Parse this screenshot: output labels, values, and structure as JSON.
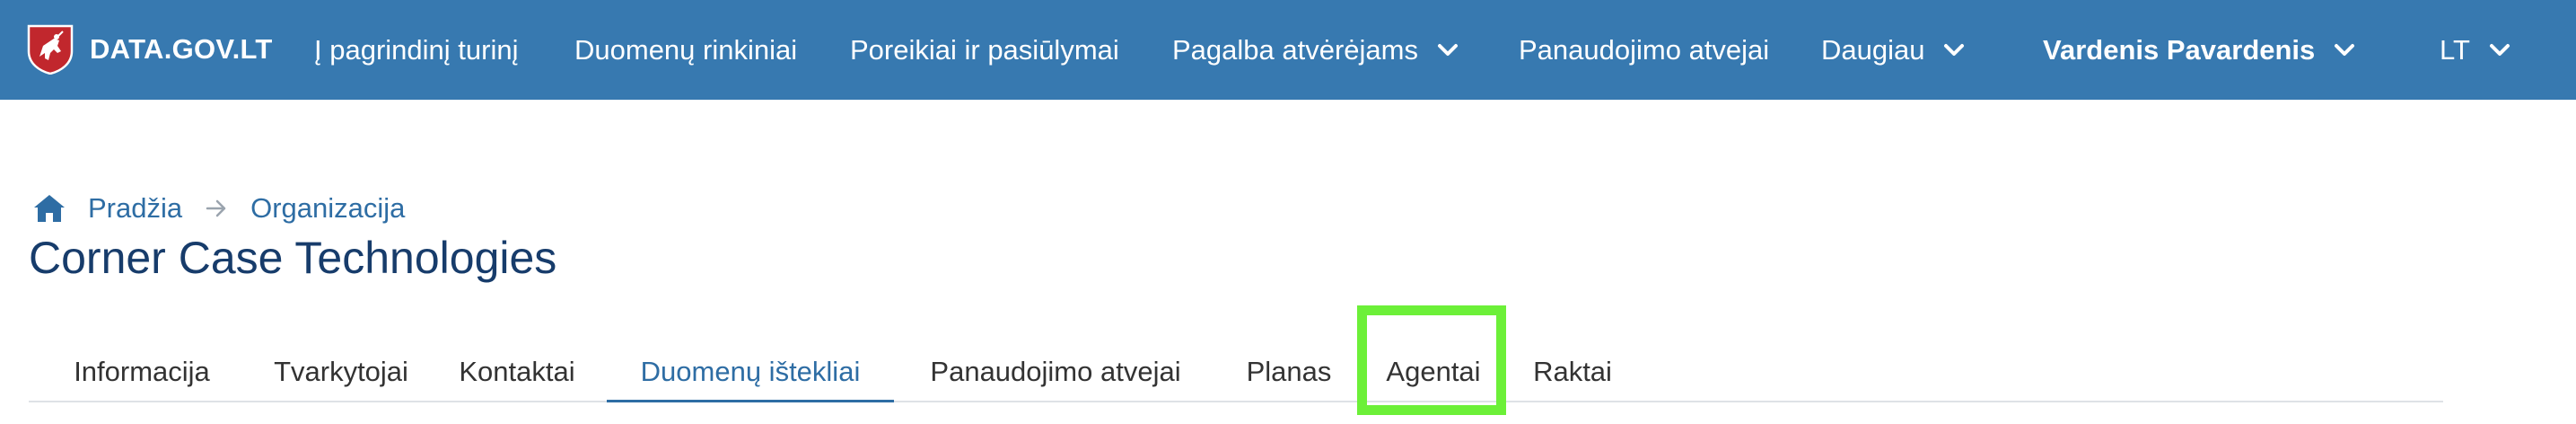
{
  "header": {
    "site_name": "DATA.GOV.LT",
    "nav": {
      "main_content": "Į pagrindinį turinį",
      "datasets": "Duomenų rinkiniai",
      "requests": "Poreikiai ir pasiūlymai",
      "help": "Pagalba atvėrėjams",
      "use_cases": "Panaudojimo atvejai",
      "more": "Daugiau",
      "user": "Vardenis Pavardenis",
      "language": "LT"
    }
  },
  "breadcrumb": {
    "home": "Pradžia",
    "organization": "Organizacija"
  },
  "page": {
    "title": "Corner Case Technologies"
  },
  "tabs": {
    "info": "Informacija",
    "managers": "Tvarkytojai",
    "contacts": "Kontaktai",
    "resources": "Duomenų ištekliai",
    "use_cases": "Panaudojimo atvejai",
    "plan": "Planas",
    "agents": "Agentai",
    "keys": "Raktai",
    "active": "resources"
  },
  "colors": {
    "header_bg": "#3779b0",
    "link": "#2e6da4",
    "title": "#173c6b",
    "highlight": "#6cf038"
  }
}
